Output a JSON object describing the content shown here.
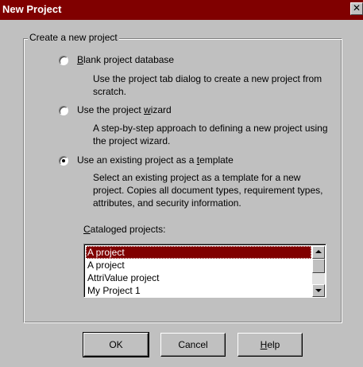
{
  "window": {
    "title": "New Project",
    "close_glyph": "✕"
  },
  "group": {
    "label": "Create a new project"
  },
  "options": [
    {
      "label_mnemonic": "B",
      "label_rest": "lank project database",
      "description": "Use the project tab dialog to create a new project from scratch.",
      "selected": false
    },
    {
      "label_before": "Use the project ",
      "label_mnemonic": "w",
      "label_after": "izard",
      "description": "A step-by-step approach to defining a new project using the project wizard.",
      "selected": false
    },
    {
      "label_before": "Use an existing project as a ",
      "label_mnemonic": "t",
      "label_after": "emplate",
      "description": "Select an existing project as a template for a new project. Copies all document types, requirement types, attributes, and security information.",
      "selected": true
    }
  ],
  "cataloged": {
    "label_mnemonic": "C",
    "label_rest": "ataloged projects:",
    "items": [
      "A project",
      "A project",
      "AttriValue project",
      "My Project 1"
    ],
    "selected_index": 0
  },
  "buttons": {
    "ok": "OK",
    "cancel": "Cancel",
    "help_mnemonic": "H",
    "help_rest": "elp"
  },
  "colors": {
    "titlebar": "#800000",
    "selection": "#800000",
    "face": "#c0c0c0"
  }
}
